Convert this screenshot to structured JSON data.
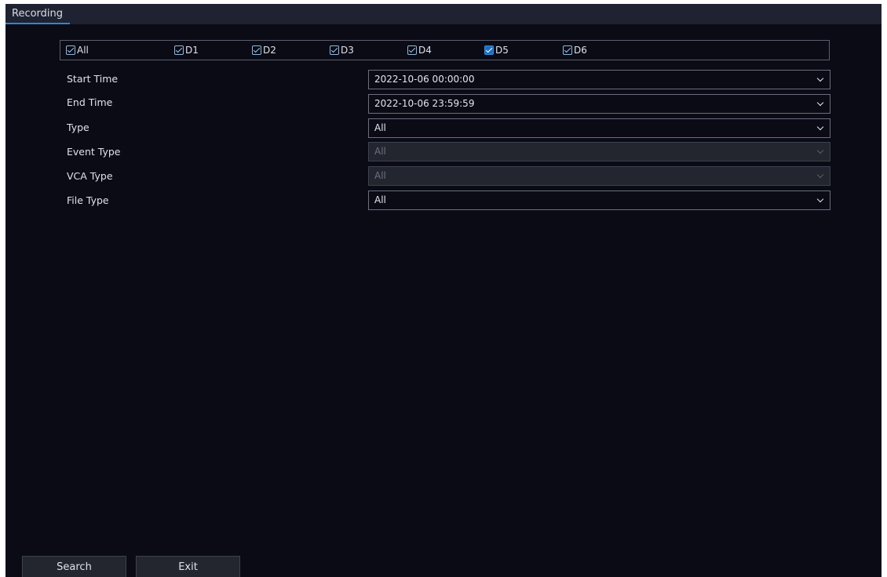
{
  "tab": {
    "label": "Recording"
  },
  "channels": [
    {
      "label": "All",
      "checked": true,
      "active": false
    },
    {
      "label": "D1",
      "checked": true,
      "active": false
    },
    {
      "label": "D2",
      "checked": true,
      "active": false
    },
    {
      "label": "D3",
      "checked": true,
      "active": false
    },
    {
      "label": "D4",
      "checked": true,
      "active": false
    },
    {
      "label": "D5",
      "checked": true,
      "active": true
    },
    {
      "label": "D6",
      "checked": true,
      "active": false
    }
  ],
  "form": {
    "start_time": {
      "label": "Start Time",
      "value": "2022-10-06 00:00:00"
    },
    "end_time": {
      "label": "End Time",
      "value": "2022-10-06 23:59:59"
    },
    "type": {
      "label": "Type",
      "value": "All"
    },
    "event_type": {
      "label": "Event Type",
      "value": "All",
      "disabled": true
    },
    "vca_type": {
      "label": "VCA Type",
      "value": "All",
      "disabled": true
    },
    "file_type": {
      "label": "File Type",
      "value": "All"
    }
  },
  "buttons": {
    "search": "Search",
    "exit": "Exit"
  },
  "colors": {
    "background": "#0a0b15",
    "accent": "#2f86d8",
    "disabled_field": "#23252f"
  },
  "icons": {
    "dropdown": "chevron-down-icon",
    "checkbox": "checkbox-checked-icon"
  }
}
